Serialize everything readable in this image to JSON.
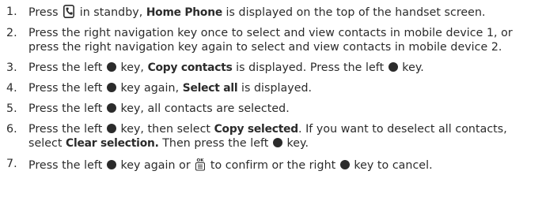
{
  "steps": [
    {
      "num": "1.",
      "parts": [
        {
          "t": "Press "
        },
        {
          "icon": "phone-key-icon"
        },
        {
          "t": " in standby, "
        },
        {
          "b": "Home Phone"
        },
        {
          "t": " is displayed on the top of the handset screen."
        }
      ]
    },
    {
      "num": "2.",
      "parts": [
        {
          "t": "Press the right navigation key once to select and view contacts in mobile device 1, or press the right navigation key again to select and view contacts in mobile device 2."
        }
      ]
    },
    {
      "num": "3.",
      "parts": [
        {
          "t": "Press the left "
        },
        {
          "icon": "softkey-dot-icon"
        },
        {
          "t": " key, "
        },
        {
          "b": "Copy contacts"
        },
        {
          "t": " is displayed. Press the left "
        },
        {
          "icon": "softkey-dot-icon"
        },
        {
          "t": " key."
        }
      ]
    },
    {
      "num": "4.",
      "parts": [
        {
          "t": "Press the left "
        },
        {
          "icon": "softkey-dot-icon"
        },
        {
          "t": " key again, "
        },
        {
          "b": "Select all"
        },
        {
          "t": " is displayed."
        }
      ]
    },
    {
      "num": "5.",
      "parts": [
        {
          "t": "Press the left "
        },
        {
          "icon": "softkey-dot-icon"
        },
        {
          "t": " key, all contacts are selected."
        }
      ]
    },
    {
      "num": "6.",
      "parts": [
        {
          "t": "Press the left "
        },
        {
          "icon": "softkey-dot-icon"
        },
        {
          "t": " key, then select "
        },
        {
          "b": "Copy selected"
        },
        {
          "t": ". If you want to deselect all contacts, select "
        },
        {
          "b": "Clear selection."
        },
        {
          "t": " Then press the left "
        },
        {
          "icon": "softkey-dot-icon"
        },
        {
          "t": " key."
        }
      ]
    },
    {
      "num": "7.",
      "parts": [
        {
          "t": "Press the left "
        },
        {
          "icon": "softkey-dot-icon"
        },
        {
          "t": " key again or "
        },
        {
          "icon": "ok-menu-key-icon"
        },
        {
          "t": " to confirm or the right "
        },
        {
          "icon": "softkey-dot-icon"
        },
        {
          "t": " key to cancel."
        }
      ]
    }
  ],
  "icons": {
    "ok-menu-key-icon": {
      "label": "OK"
    }
  },
  "colors": {
    "text": "#2b2b2b"
  }
}
